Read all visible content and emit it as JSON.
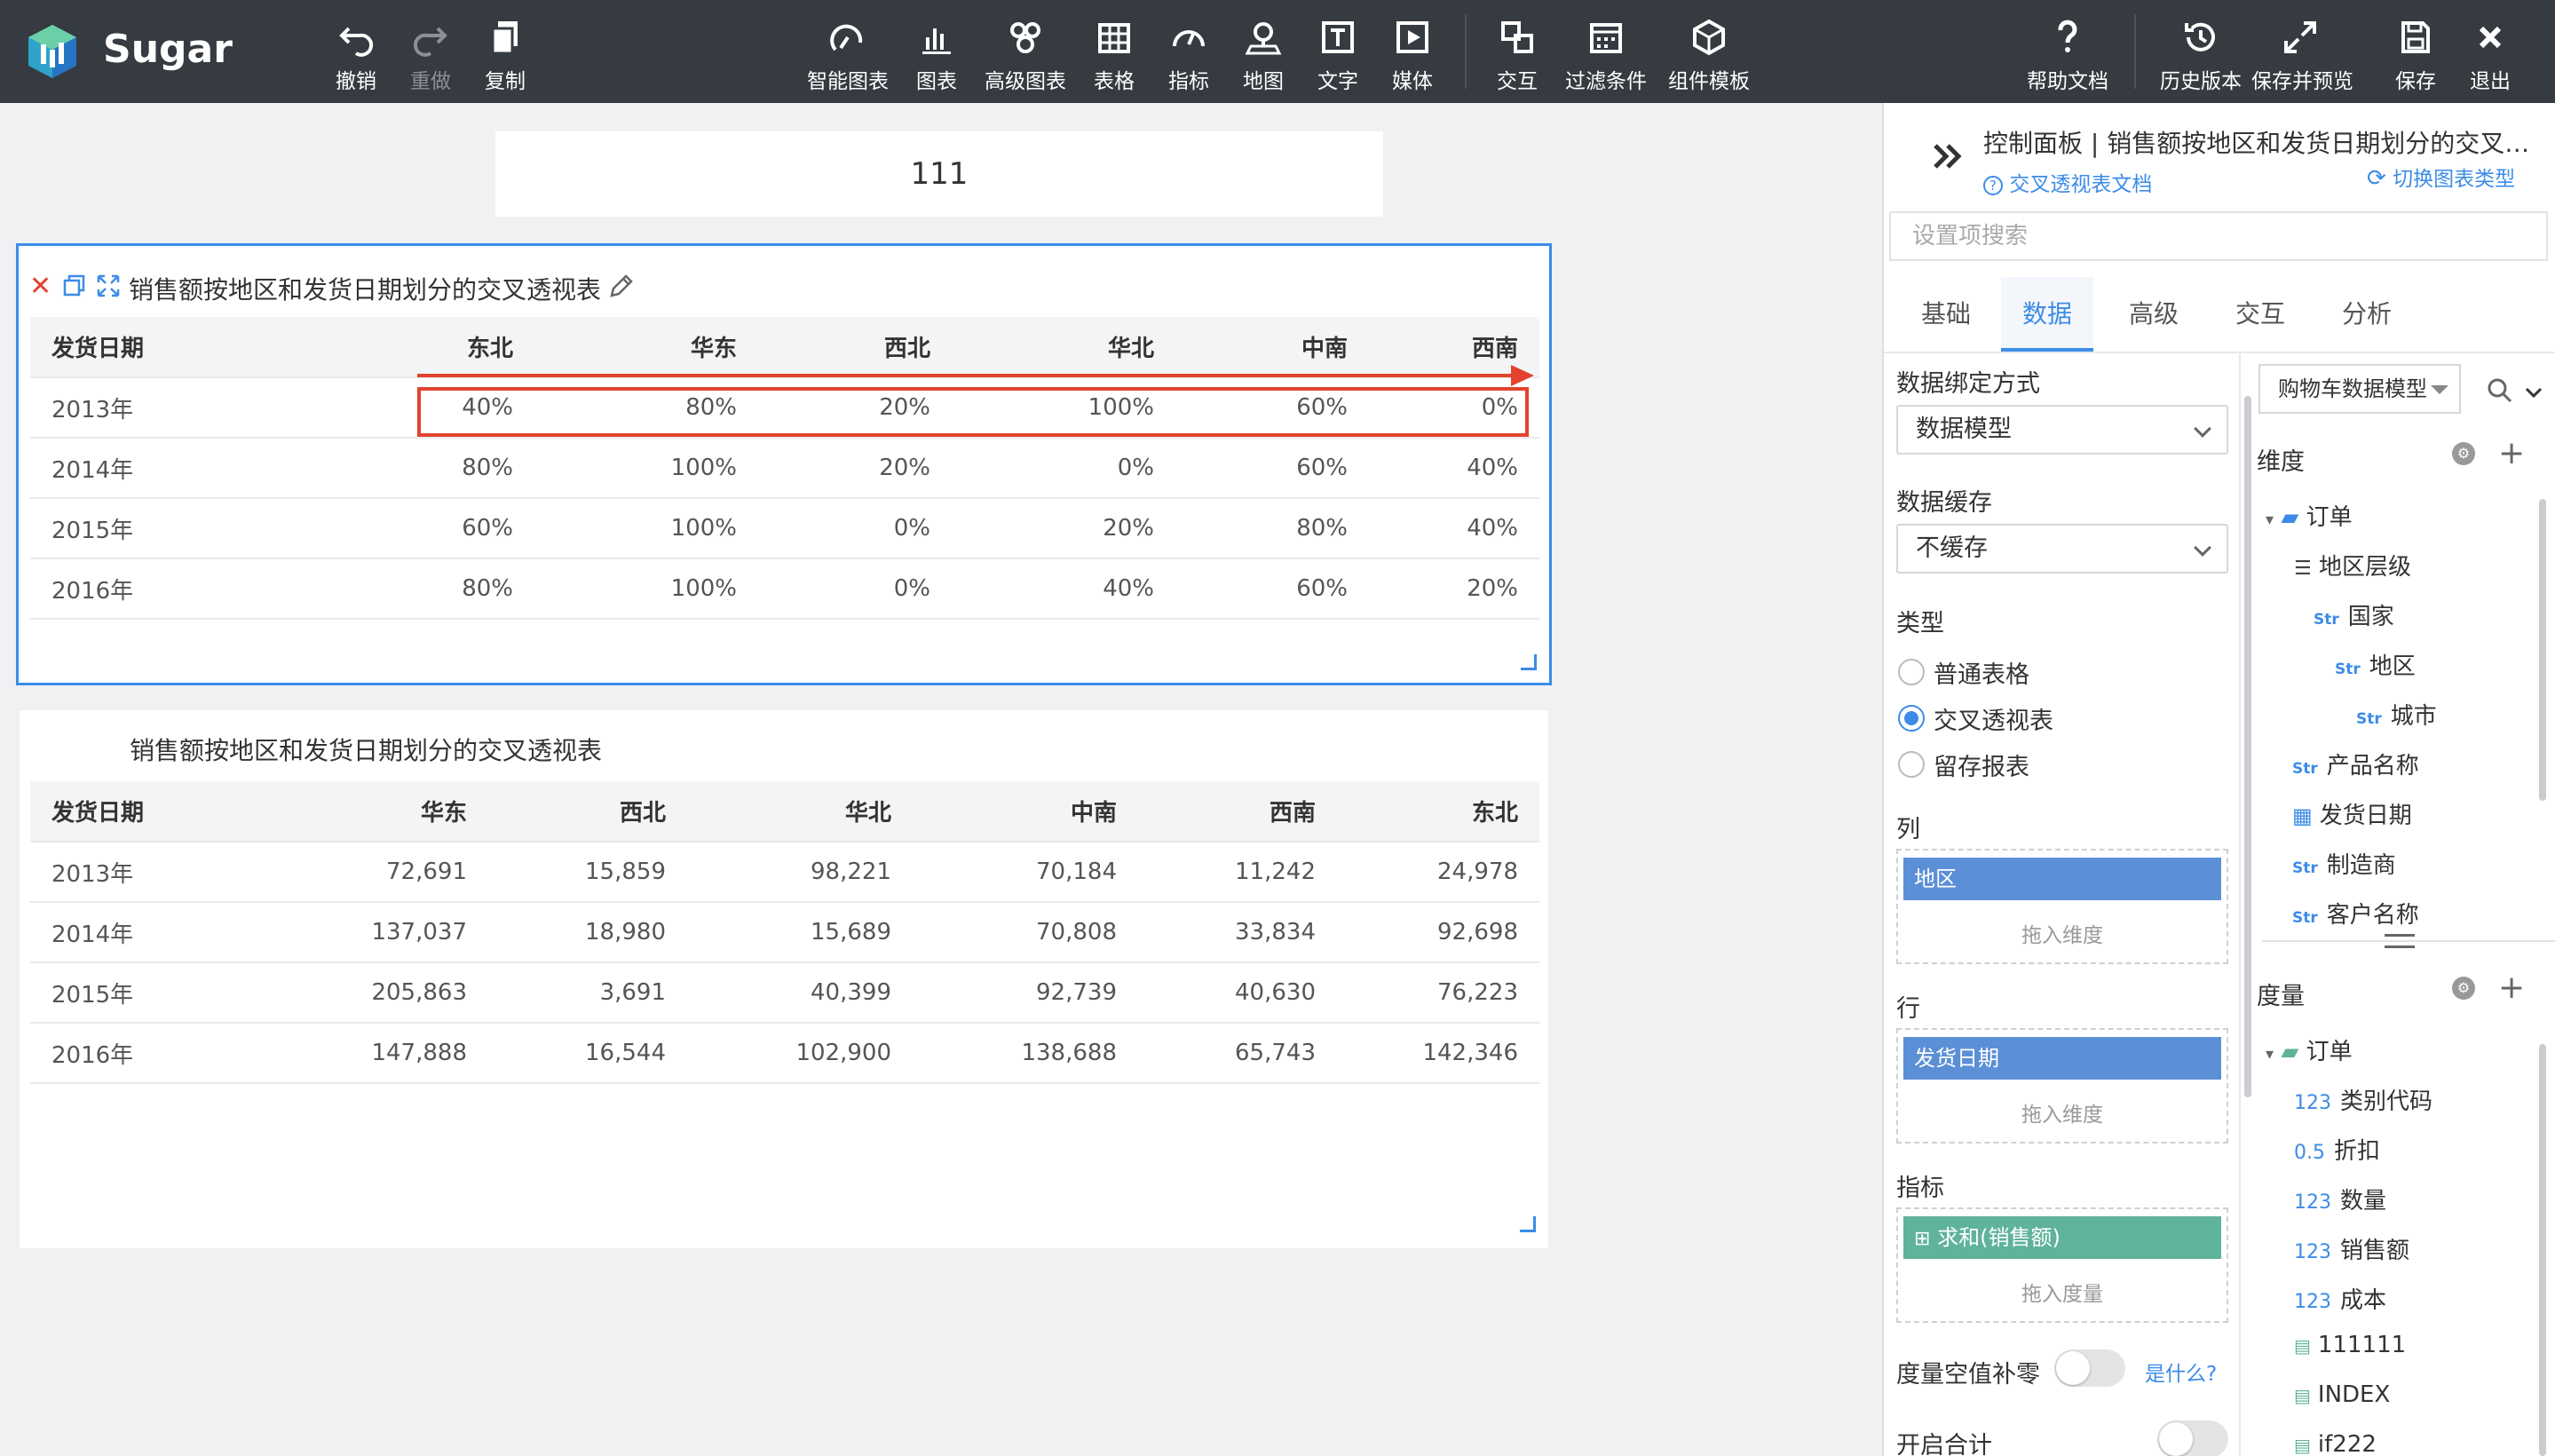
{
  "app": {
    "brand": "Sugar"
  },
  "toolbar": {
    "undo": "撤销",
    "redo": "重做",
    "copy": "复制",
    "smart_chart": "智能图表",
    "chart": "图表",
    "adv_chart": "高级图表",
    "table": "表格",
    "metric": "指标",
    "map": "地图",
    "text": "文字",
    "media": "媒体",
    "interaction": "交互",
    "filter": "过滤条件",
    "component_template": "组件模板",
    "help": "帮助文档",
    "history": "历史版本",
    "save_preview": "保存并预览",
    "save": "保存",
    "exit": "退出"
  },
  "canvas": {
    "textbox": "111",
    "widget1": {
      "title": "销售额按地区和发货日期划分的交叉透视表",
      "headers": [
        "发货日期",
        "东北",
        "华东",
        "西北",
        "华北",
        "中南",
        "西南"
      ],
      "rows": [
        [
          "2013年",
          "40%",
          "80%",
          "20%",
          "100%",
          "60%",
          "0%"
        ],
        [
          "2014年",
          "80%",
          "100%",
          "20%",
          "0%",
          "60%",
          "40%"
        ],
        [
          "2015年",
          "60%",
          "100%",
          "0%",
          "20%",
          "80%",
          "40%"
        ],
        [
          "2016年",
          "80%",
          "100%",
          "0%",
          "40%",
          "60%",
          "20%"
        ]
      ]
    },
    "widget2": {
      "title": "销售额按地区和发货日期划分的交叉透视表",
      "headers": [
        "发货日期",
        "华东",
        "西北",
        "华北",
        "中南",
        "西南",
        "东北"
      ],
      "rows": [
        [
          "2013年",
          "72,691",
          "15,859",
          "98,221",
          "70,184",
          "11,242",
          "24,978"
        ],
        [
          "2014年",
          "137,037",
          "18,980",
          "15,689",
          "70,808",
          "33,834",
          "92,698"
        ],
        [
          "2015年",
          "205,863",
          "3,691",
          "40,399",
          "92,739",
          "40,630",
          "76,223"
        ],
        [
          "2016年",
          "147,888",
          "16,544",
          "102,900",
          "138,688",
          "65,743",
          "142,346"
        ]
      ]
    }
  },
  "panel": {
    "title": "控制面板 | 销售额按地区和发货日期划分的交叉透视表",
    "doc_link": "交叉透视表文档",
    "switch_link": "切换图表类型",
    "search_placeholder": "设置项搜索",
    "tabs": [
      "基础",
      "数据",
      "高级",
      "交互",
      "分析"
    ],
    "binding_label": "数据绑定方式",
    "binding_value": "数据模型",
    "cache_label": "数据缓存",
    "cache_value": "不缓存",
    "type_label": "类型",
    "type_options": [
      "普通表格",
      "交叉透视表",
      "留存报表"
    ],
    "col_label": "列",
    "col_pill": "地区",
    "col_hint": "拖入维度",
    "row_label": "行",
    "row_pill": "发货日期",
    "row_hint": "拖入维度",
    "metric_label": "指标",
    "metric_pill": "求和(销售额)",
    "metric_hint": "拖入度量",
    "zero_fill_label": "度量空值补零",
    "what_link": "是什么?",
    "total_label": "开启合计",
    "model_select": "购物车数据模型",
    "dims_label": "维度",
    "dims": {
      "folder": "订单",
      "hier": "地区层级",
      "country": "国家",
      "region": "地区",
      "city": "城市",
      "product": "产品名称",
      "ship_date": "发货日期",
      "maker": "制造商",
      "customer": "客户名称"
    },
    "measures_label": "度量",
    "measures": {
      "folder": "订单",
      "cat": "类别代码",
      "discount": "折扣",
      "qty": "数量",
      "sales": "销售额",
      "cost": "成本",
      "m1": "111111",
      "m2": "INDEX",
      "m3": "if222"
    },
    "tag_str": "Str",
    "tag_num": "123",
    "tag_dec": "0.5"
  }
}
